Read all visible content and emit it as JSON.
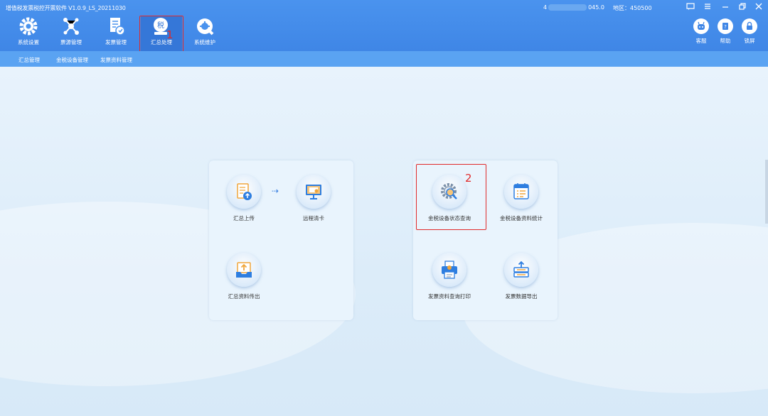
{
  "app": {
    "title": "增值税发票税控开票软件  V1.0.9_LS_20211030",
    "account_prefix": "4",
    "account_suffix": "045.0",
    "region": "地区：450500"
  },
  "toolbar": [
    {
      "label": "系统设置",
      "icon": "gear-icon"
    },
    {
      "label": "票源管理",
      "icon": "network-icon"
    },
    {
      "label": "发票管理",
      "icon": "invoice-icon"
    },
    {
      "label": "汇总处理",
      "icon": "tax-summary-icon"
    },
    {
      "label": "系统维护",
      "icon": "maintenance-icon"
    }
  ],
  "right_tools": [
    {
      "label": "客服",
      "icon": "robot-icon"
    },
    {
      "label": "帮助",
      "icon": "help-icon"
    },
    {
      "label": "锁屏",
      "icon": "lock-icon"
    }
  ],
  "subnav": [
    "汇总管理",
    "金税设备管理",
    "发票资料管理"
  ],
  "left_panel": [
    {
      "label": "汇总上传",
      "icon": "upload-doc-icon"
    },
    {
      "label": "远程清卡",
      "icon": "remote-monitor-icon"
    },
    {
      "label": "汇总资料传出",
      "icon": "export-tray-icon"
    }
  ],
  "right_panel": [
    {
      "label": "金税设备状态查询",
      "icon": "gear-search-icon"
    },
    {
      "label": "金税设备资料统计",
      "icon": "calendar-list-icon"
    },
    {
      "label": "发票资料查询打印",
      "icon": "printer-icon"
    },
    {
      "label": "发票数据导出",
      "icon": "data-export-icon"
    }
  ],
  "annotations": [
    "1",
    "2"
  ],
  "colors": {
    "header": "#4a93ee",
    "subnav": "#5aa3f2",
    "highlight": "#e02a2a",
    "accent": "#3a7fe0"
  }
}
